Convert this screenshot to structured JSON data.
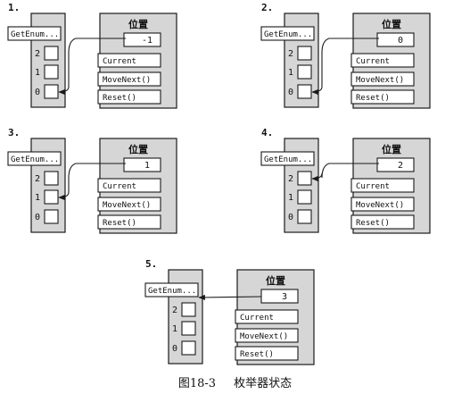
{
  "title_label": "位置",
  "getenum_label": "GetEnum...",
  "slot_labels": [
    "2",
    "1",
    "0"
  ],
  "method_labels": [
    "Current",
    "MoveNext()",
    "Reset()"
  ],
  "panels": [
    {
      "step": "1.",
      "position_value": "-1"
    },
    {
      "step": "2.",
      "position_value": "0"
    },
    {
      "step": "3.",
      "position_value": "1"
    },
    {
      "step": "4.",
      "position_value": "2"
    },
    {
      "step": "5.",
      "position_value": "3"
    }
  ],
  "caption": {
    "figure": "图18-3",
    "text": "枚举器状态"
  },
  "colors": {
    "fill": "#d6d6d6",
    "stroke": "#1a1a1a",
    "white": "#ffffff"
  }
}
